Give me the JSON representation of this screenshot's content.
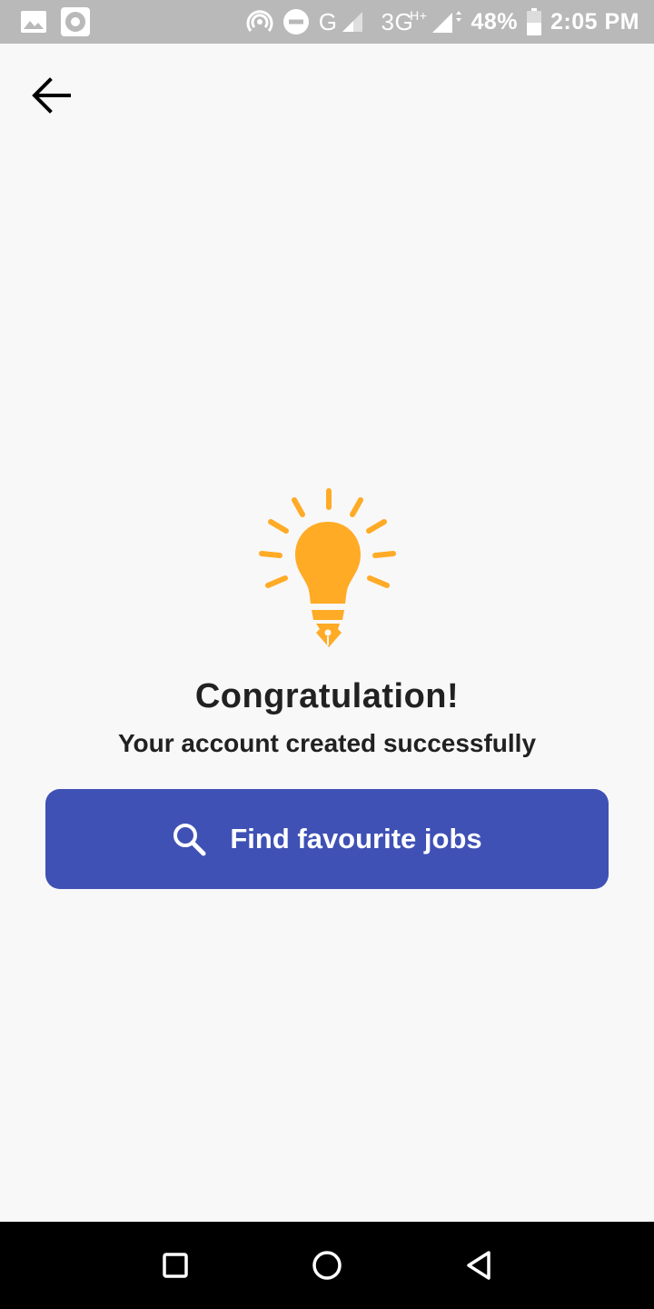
{
  "status_bar": {
    "network_type": "G",
    "network_type_2": "3G",
    "network_sup": "H+",
    "battery": "48%",
    "time": "2:05 PM",
    "icons": [
      "image-icon",
      "record-icon",
      "hotspot-icon",
      "do-not-disturb-icon",
      "signal-icon",
      "signal-icon",
      "battery-icon"
    ]
  },
  "header": {
    "back_icon": "arrow-left-icon"
  },
  "main": {
    "illustration": "lightbulb-pen-icon",
    "title": "Congratulation!",
    "subtitle": "Your account created successfully",
    "button_label": "Find favourite jobs",
    "button_icon": "search-icon"
  },
  "nav_bar": {
    "icons": [
      "recents-square-icon",
      "home-circle-icon",
      "back-triangle-icon"
    ]
  },
  "colors": {
    "accent": "#3f51b5",
    "bulb": "#ffab26",
    "background": "#f8f8f8",
    "status_bar": "#b9b9b9",
    "text": "#212121"
  }
}
